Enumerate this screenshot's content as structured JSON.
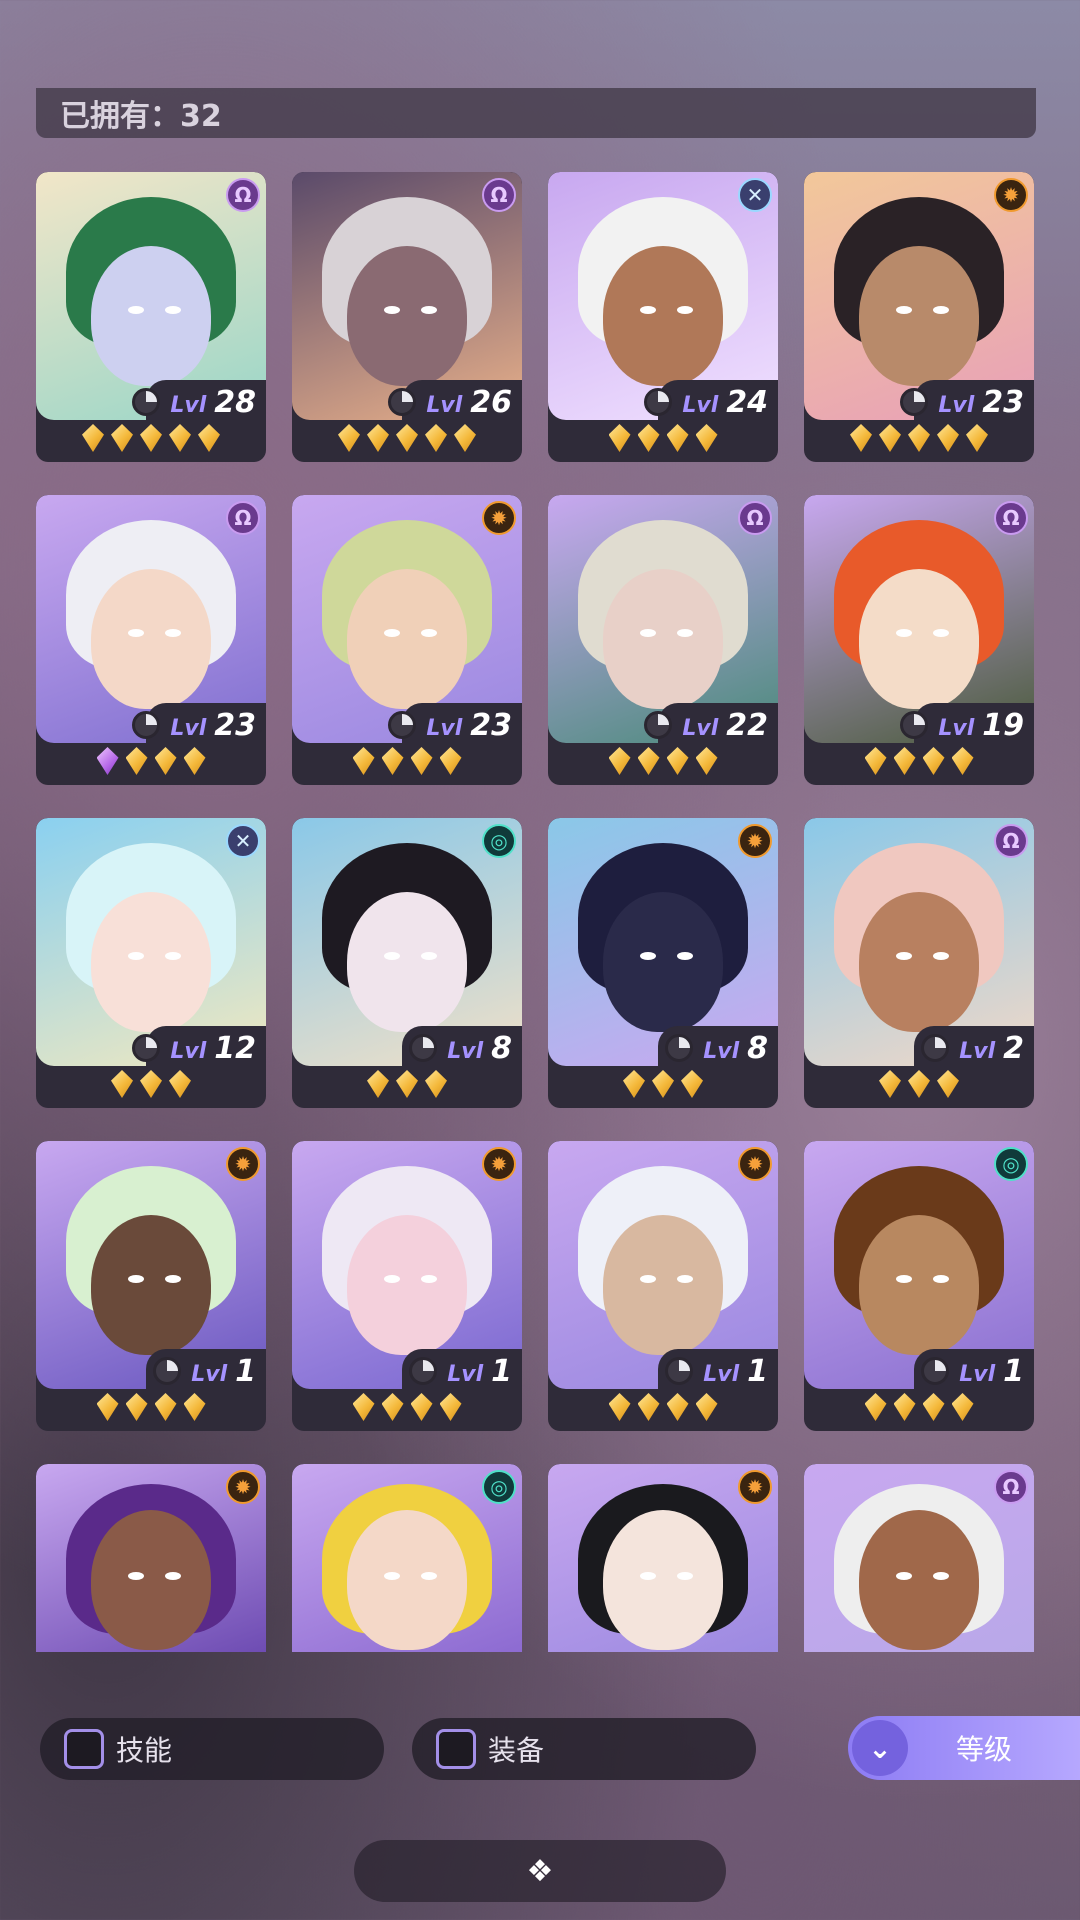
{
  "owned": {
    "label": "已拥有：32"
  },
  "cards": [
    {
      "level": "28",
      "stars": 5,
      "element": "purple",
      "element_icon": "moon-arc-icon",
      "bg": [
        "#f2e6c8",
        "#9ad6c8"
      ],
      "hair": "#2a7a4a",
      "skin": "#cdd0f0",
      "gems": [
        "gold",
        "gold",
        "gold",
        "gold",
        "gold"
      ]
    },
    {
      "level": "26",
      "stars": 5,
      "element": "purple",
      "element_icon": "moon-arc-icon",
      "bg": [
        "#5a4a6a",
        "#e8b08a"
      ],
      "hair": "#d8d2d6",
      "skin": "#8a6a72",
      "gems": [
        "gold",
        "gold",
        "gold",
        "gold",
        "gold"
      ]
    },
    {
      "level": "24",
      "stars": 4,
      "element": "blue",
      "element_icon": "cross-circle-icon",
      "bg": [
        "#c8a8f0",
        "#f0e0ff"
      ],
      "hair": "#f2f2f2",
      "skin": "#b07858",
      "gems": [
        "gold",
        "gold",
        "gold",
        "gold"
      ]
    },
    {
      "level": "23",
      "stars": 5,
      "element": "orange",
      "element_icon": "sun-gear-icon",
      "bg": [
        "#f2c89a",
        "#e8a0b8"
      ],
      "hair": "#2a2226",
      "skin": "#b88a6a",
      "gems": [
        "gold",
        "gold",
        "gold",
        "gold",
        "gold"
      ]
    },
    {
      "level": "23",
      "stars": 4,
      "element": "purple",
      "element_icon": "moon-arc-icon",
      "bg": [
        "#c8a8f0",
        "#8070d0"
      ],
      "hair": "#eeeef4",
      "skin": "#f4d8c8",
      "gems": [
        "purple",
        "gold",
        "gold",
        "gold"
      ]
    },
    {
      "level": "23",
      "stars": 4,
      "element": "orange",
      "element_icon": "sun-gear-icon",
      "bg": [
        "#c8a8f0",
        "#9a88e0"
      ],
      "hair": "#cfd89a",
      "skin": "#f0d0b8",
      "gems": [
        "gold",
        "gold",
        "gold",
        "gold"
      ]
    },
    {
      "level": "22",
      "stars": 4,
      "element": "purple",
      "element_icon": "moon-arc-icon",
      "bg": [
        "#c8a8f0",
        "#4a8a7a"
      ],
      "hair": "#e0dcd0",
      "skin": "#e8d0c8",
      "gems": [
        "gold",
        "gold",
        "gold",
        "gold"
      ]
    },
    {
      "level": "19",
      "stars": 4,
      "element": "purple",
      "element_icon": "moon-arc-icon",
      "bg": [
        "#c8a8f0",
        "#4a5a3a"
      ],
      "hair": "#e85a2a",
      "skin": "#f4dcc8",
      "gems": [
        "gold",
        "gold",
        "gold",
        "gold"
      ]
    },
    {
      "level": "12",
      "stars": 3,
      "element": "blue",
      "element_icon": "cross-circle-icon",
      "bg": [
        "#8ad0f0",
        "#f0e8c0"
      ],
      "hair": "#d8f4f8",
      "skin": "#f8e0d8",
      "gems": [
        "gold",
        "gold",
        "gold"
      ]
    },
    {
      "level": "8",
      "stars": 3,
      "element": "teal",
      "element_icon": "swirl-icon",
      "bg": [
        "#8ac8e8",
        "#f0e0c8"
      ],
      "hair": "#1e1a22",
      "skin": "#f0e4ec",
      "gems": [
        "gold",
        "gold",
        "gold"
      ]
    },
    {
      "level": "8",
      "stars": 3,
      "element": "orange",
      "element_icon": "sun-gear-icon",
      "bg": [
        "#8ac8e8",
        "#c8a8f0"
      ],
      "hair": "#1e1e3e",
      "skin": "#2a2a4a",
      "gems": [
        "gold",
        "gold",
        "gold"
      ]
    },
    {
      "level": "2",
      "stars": 3,
      "element": "purple",
      "element_icon": "moon-arc-icon",
      "bg": [
        "#8ac8e8",
        "#f0d8c8"
      ],
      "hair": "#f0c8c0",
      "skin": "#b88060",
      "gems": [
        "gold",
        "gold",
        "gold"
      ]
    },
    {
      "level": "1",
      "stars": 4,
      "element": "orange",
      "element_icon": "sun-gear-icon",
      "bg": [
        "#c8a8f0",
        "#6a58c0"
      ],
      "hair": "#d8f0d0",
      "skin": "#6a4a3a",
      "gems": [
        "gold",
        "gold",
        "gold",
        "gold"
      ]
    },
    {
      "level": "1",
      "stars": 4,
      "element": "orange",
      "element_icon": "sun-gear-icon",
      "bg": [
        "#c8a8f0",
        "#7a68d0"
      ],
      "hair": "#eee8f4",
      "skin": "#f4d0dc",
      "gems": [
        "gold",
        "gold",
        "gold",
        "gold"
      ]
    },
    {
      "level": "1",
      "stars": 4,
      "element": "orange",
      "element_icon": "sun-gear-icon",
      "bg": [
        "#c8a8f0",
        "#9a88e0"
      ],
      "hair": "#eef0f8",
      "skin": "#d8b8a0",
      "gems": [
        "gold",
        "gold",
        "gold",
        "gold"
      ]
    },
    {
      "level": "1",
      "stars": 4,
      "element": "teal",
      "element_icon": "swirl-icon",
      "bg": [
        "#c8a8f0",
        "#8a70d0"
      ],
      "hair": "#6a3a1a",
      "skin": "#b88860",
      "gems": [
        "gold",
        "gold",
        "gold",
        "gold"
      ]
    },
    {
      "level": "",
      "stars": 0,
      "element": "orange",
      "element_icon": "sun-gear-icon",
      "bg": [
        "#c8a8f0",
        "#6a48b0"
      ],
      "hair": "#5a2a8a",
      "skin": "#8a5a48",
      "gems": []
    },
    {
      "level": "",
      "stars": 0,
      "element": "teal",
      "element_icon": "swirl-icon",
      "bg": [
        "#c8a8f0",
        "#8a68d0"
      ],
      "hair": "#f0d040",
      "skin": "#f4d8c8",
      "gems": []
    },
    {
      "level": "",
      "stars": 0,
      "element": "orange",
      "element_icon": "sun-gear-icon",
      "bg": [
        "#c8a8f0",
        "#9a88e0"
      ],
      "hair": "#1a1a1e",
      "skin": "#f4e4dc",
      "gems": []
    },
    {
      "level": "",
      "stars": 0,
      "element": "purple",
      "element_icon": "moon-arc-icon",
      "bg": [
        "#c8a8f0",
        "#b8a8e8"
      ],
      "hair": "#eeeeee",
      "skin": "#a0684a",
      "gems": []
    }
  ],
  "filters": {
    "skill_label": "技能",
    "equipment_label": "装备",
    "sort_label": "等级",
    "sort_icon": "double-chevron-down-icon",
    "collapse_icon": "diamond-cluster-icon"
  },
  "level_prefix": "Lvl"
}
